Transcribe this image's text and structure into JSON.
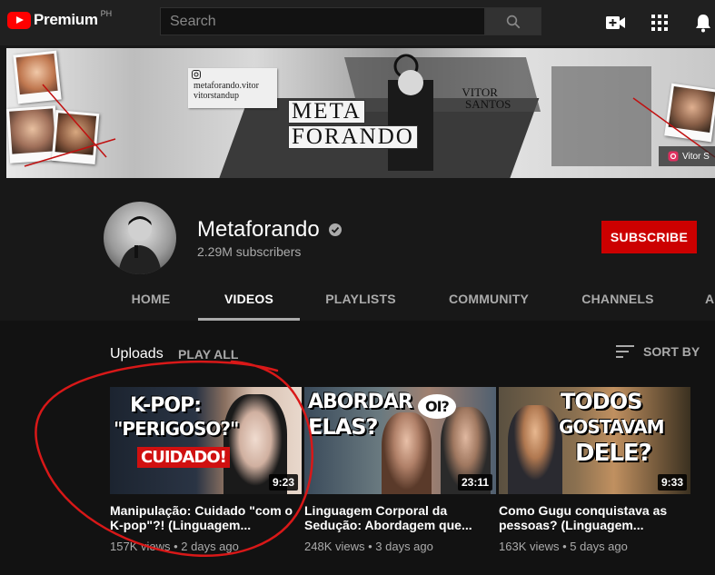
{
  "masthead": {
    "logo_text": "Premium",
    "logo_country": "PH",
    "search_placeholder": "Search"
  },
  "banner": {
    "instagram_handles": [
      "metaforando.vitor",
      "vitorstandup"
    ],
    "title_lines": [
      "META",
      "FORANDO"
    ],
    "subtitle_lines": [
      "VITOR",
      "SANTOS"
    ],
    "social_label": "Vitor S"
  },
  "channel": {
    "name": "Metaforando",
    "subscribers": "2.29M subscribers",
    "subscribe_label": "SUBSCRIBE"
  },
  "tabs": [
    {
      "label": "HOME"
    },
    {
      "label": "VIDEOS"
    },
    {
      "label": "PLAYLISTS"
    },
    {
      "label": "COMMUNITY"
    },
    {
      "label": "CHANNELS"
    },
    {
      "label": "A"
    }
  ],
  "section": {
    "title": "Uploads",
    "play_all": "PLAY ALL",
    "sort_label": "SORT BY"
  },
  "videos": [
    {
      "thumb_lines": [
        "K-POP:",
        "\"PERIGOSO?\"",
        "CUIDADO!"
      ],
      "duration": "9:23",
      "title": "Manipulação: Cuidado \"com o K-pop\"?! (Linguagem...",
      "views": "157K views",
      "age": "2 days ago"
    },
    {
      "thumb_lines": [
        "ABORDAR",
        "ELAS?",
        "OI?"
      ],
      "duration": "23:11",
      "title": "Linguagem Corporal da Sedução: Abordagem que...",
      "views": "248K views",
      "age": "3 days ago"
    },
    {
      "thumb_lines": [
        "TODOS",
        "GOSTAVAM",
        "DELE?"
      ],
      "duration": "9:33",
      "title": "Como Gugu conquistava as pessoas? (Linguagem...",
      "views": "163K views",
      "age": "5 days ago"
    }
  ],
  "colors": {
    "brand_red": "#ff0000",
    "subscribe_red": "#cc0000",
    "annotation_red": "#d81818",
    "background": "#181818"
  }
}
